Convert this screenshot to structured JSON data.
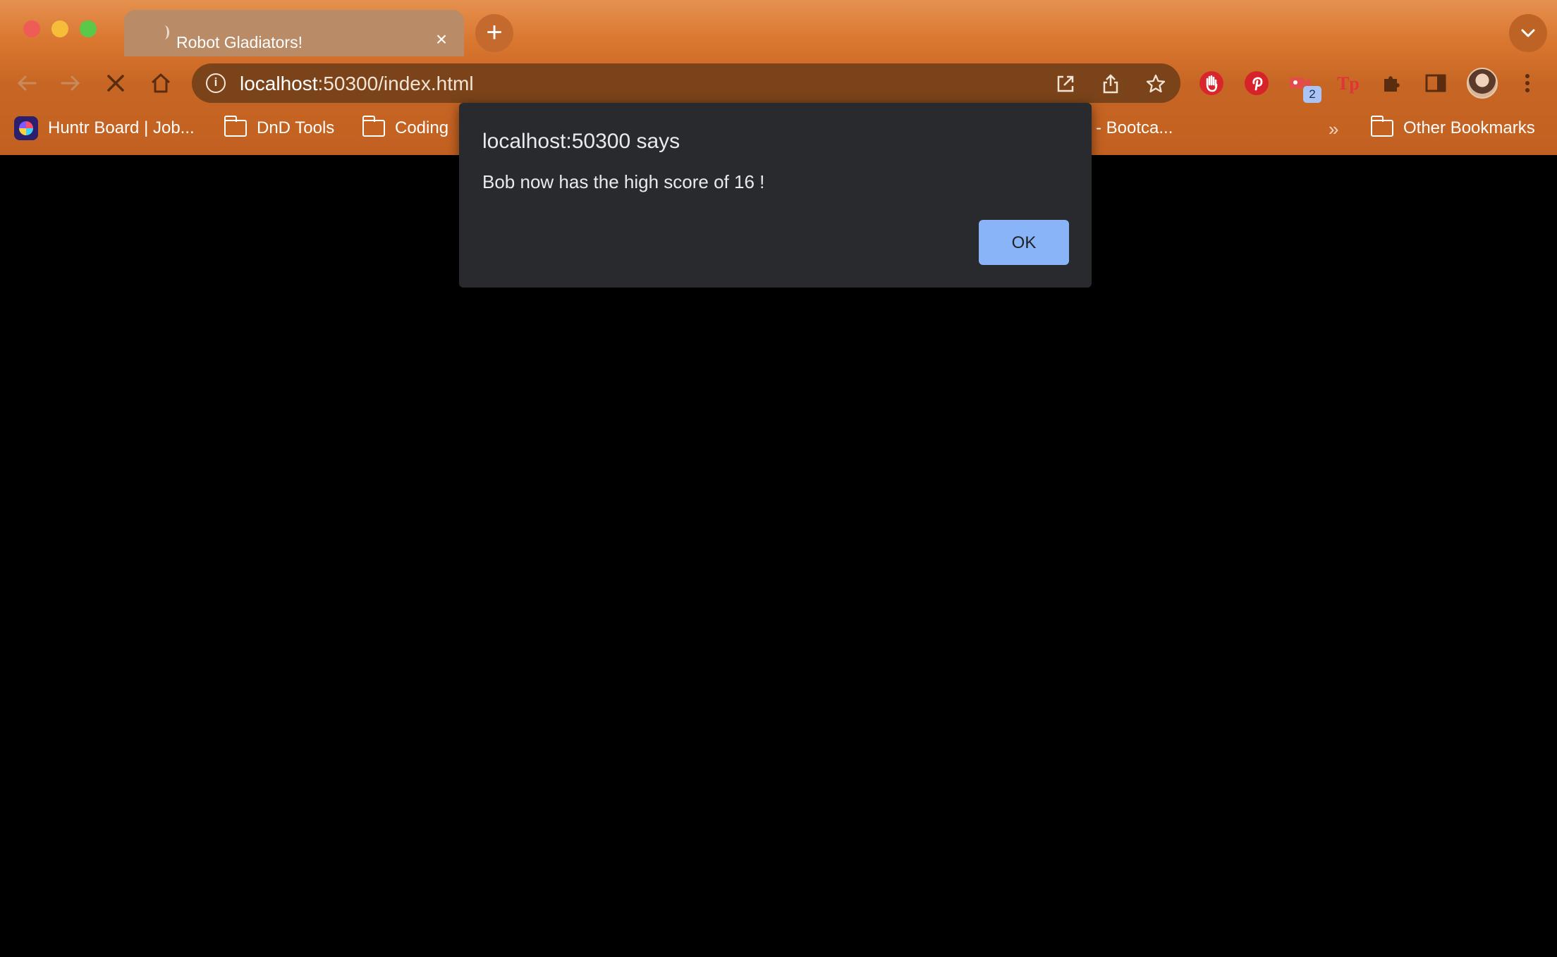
{
  "browser": {
    "tab": {
      "title": "Robot Gladiators!"
    },
    "address": {
      "host": "localhost",
      "rest": ":50300/index.html"
    },
    "extension_badge": "2",
    "bookmarks": [
      {
        "label": "Huntr Board | Job...",
        "icon": "huntr-icon"
      },
      {
        "label": "DnD Tools",
        "icon": "folder-icon"
      },
      {
        "label": "Coding",
        "icon": "folder-icon"
      },
      {
        "label": "- Bootca...",
        "icon": ""
      }
    ],
    "bookmarks_overflow": "»",
    "other_bookmarks": "Other Bookmarks"
  },
  "dialog": {
    "title": "localhost:50300 says",
    "message": "Bob now has the high score of 16 !",
    "ok_label": "OK"
  },
  "colors": {
    "chrome_top": "#e5914f",
    "chrome_bottom": "#c26021",
    "dialog_bg": "#292a2d",
    "ok_button": "#8ab4f8",
    "page_bg": "#000000"
  }
}
